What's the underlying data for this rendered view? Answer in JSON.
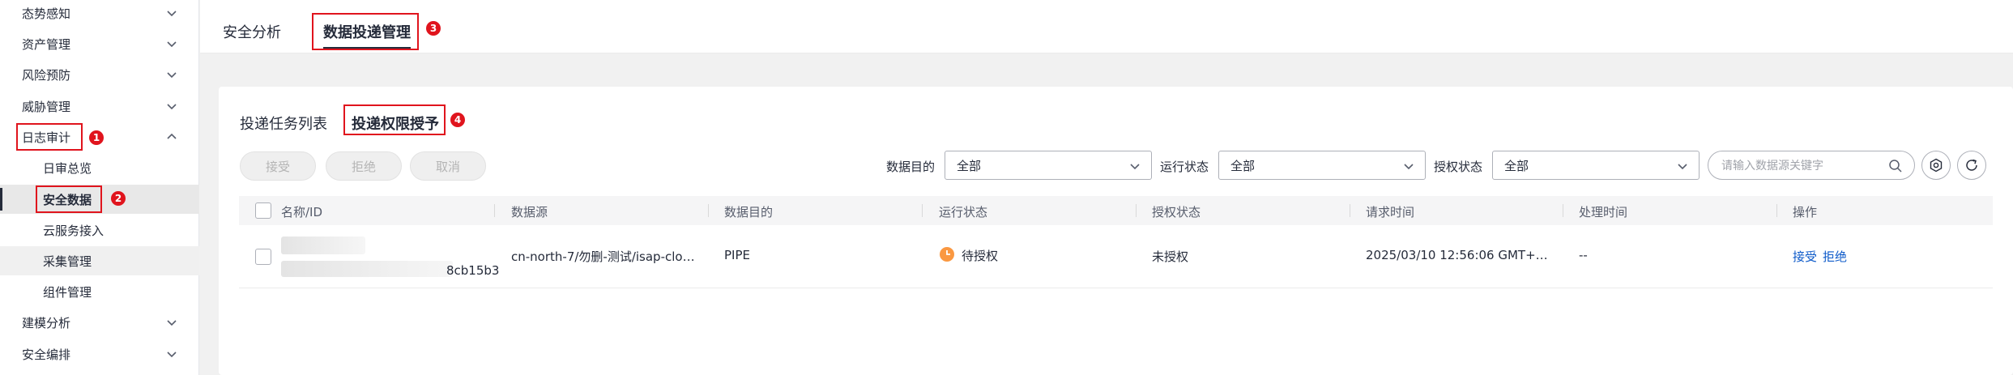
{
  "sidebar": {
    "items": [
      {
        "label": "态势感知"
      },
      {
        "label": "资产管理"
      },
      {
        "label": "风险预防"
      },
      {
        "label": "威胁管理"
      },
      {
        "label": "日志审计"
      },
      {
        "label": "日审总览"
      },
      {
        "label": "安全数据"
      },
      {
        "label": "云服务接入"
      },
      {
        "label": "采集管理"
      },
      {
        "label": "组件管理"
      },
      {
        "label": "建模分析"
      },
      {
        "label": "安全编排"
      }
    ]
  },
  "annotations": {
    "b1": "1",
    "b2": "2",
    "b3": "3",
    "b4": "4"
  },
  "tabs": {
    "security_analysis": "安全分析",
    "data_delivery": "数据投递管理"
  },
  "subtabs": {
    "task_list": "投递任务列表",
    "permission_grant": "投递权限授予"
  },
  "actions": {
    "accept": "接受",
    "reject": "拒绝",
    "cancel": "取消"
  },
  "filters": {
    "data_dest_label": "数据目的",
    "data_dest_value": "全部",
    "run_status_label": "运行状态",
    "run_status_value": "全部",
    "auth_status_label": "授权状态",
    "auth_status_value": "全部",
    "search_placeholder": "请输入数据源关键字"
  },
  "table": {
    "columns": [
      "名称/ID",
      "数据源",
      "数据目的",
      "运行状态",
      "授权状态",
      "请求时间",
      "处理时间",
      "操作"
    ],
    "rows": [
      {
        "id_suffix": "8cb15b3",
        "source": "cn-north-7/勿删-测试/isap-clou...",
        "dest": "PIPE",
        "run_status": "待授权",
        "auth_status": "未授权",
        "request_time": "2025/03/10 12:56:06 GMT+08...",
        "process_time": "--",
        "op_accept": "接受",
        "op_reject": "拒绝"
      }
    ]
  },
  "colors": {
    "accent": "#0d5ac9",
    "annotation": "#e0141d",
    "pending": "#fa9841"
  }
}
